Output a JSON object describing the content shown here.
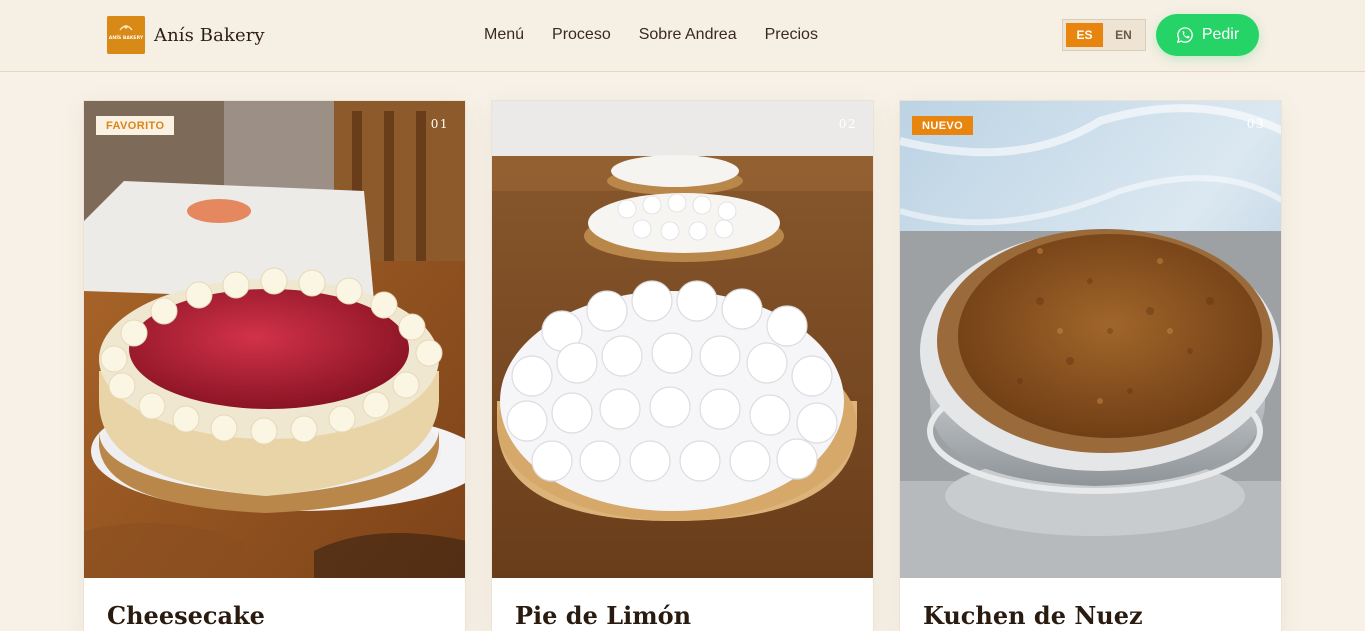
{
  "brand": {
    "name": "Anís Bakery",
    "logo_text": "ANÍS BAKERY"
  },
  "nav": {
    "links": [
      "Menú",
      "Proceso",
      "Sobre Andrea",
      "Precios"
    ]
  },
  "lang": {
    "options": [
      "ES",
      "EN"
    ],
    "active": "ES"
  },
  "order": {
    "label": "Pedir",
    "icon": "whatsapp-icon"
  },
  "colors": {
    "accent": "#e8850f",
    "whatsapp": "#25d366",
    "background": "#f7f1e7"
  },
  "products": [
    {
      "badge": "FAVORITO",
      "number": "01",
      "title": "Cheesecake",
      "image": "cheesecake-photo"
    },
    {
      "badge": "",
      "number": "02",
      "title": "Pie de Limón",
      "image": "lemon-pie-photo"
    },
    {
      "badge": "NUEVO",
      "number": "03",
      "title": "Kuchen de Nuez",
      "image": "walnut-kuchen-photo"
    }
  ]
}
